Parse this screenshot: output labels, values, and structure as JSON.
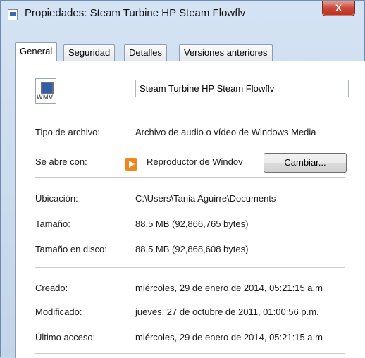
{
  "window": {
    "title": "Propiedades: Steam Turbine HP Steam Flowflv",
    "close_glyph": "X"
  },
  "tabs": [
    {
      "label": "General",
      "active": true
    },
    {
      "label": "Seguridad",
      "active": false
    },
    {
      "label": "Detalles",
      "active": false
    },
    {
      "label": "Versiones anteriores",
      "active": false
    }
  ],
  "general": {
    "file_icon_text": "WMV",
    "file_name": "Steam Turbine HP Steam Flowflv",
    "tipo_label": "Tipo de archivo:",
    "tipo_value": "Archivo de audio o vídeo de Windows Media",
    "abre_label": "Se abre con:",
    "abre_value": "Reproductor de Windov",
    "change_button": "Cambiar...",
    "ubicacion_label": "Ubicación:",
    "ubicacion_value": "C:\\Users\\Tania Aguirre\\Documents",
    "tamano_label": "Tamaño:",
    "tamano_value": "88.5 MB (92,866,765 bytes)",
    "tamano_disco_label": "Tamaño en disco:",
    "tamano_disco_value": "88.5 MB (92,868,608 bytes)",
    "creado_label": "Creado:",
    "creado_value": "miércoles, 29 de enero de 2014, 05:21:15 a.m",
    "modificado_label": "Modificado:",
    "modificado_value": "jueves, 27 de octubre de 2011, 01:00:56 p.m.",
    "acceso_label": "Último acceso:",
    "acceso_value": "miércoles, 29 de enero de 2014, 05:21:15 a.m"
  }
}
